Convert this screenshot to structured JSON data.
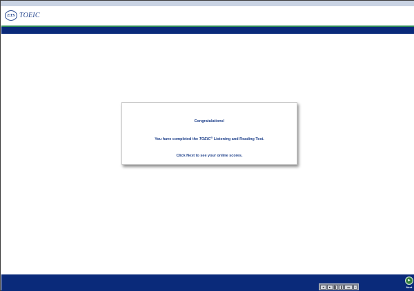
{
  "header": {
    "logo_ets": "ETS",
    "logo_product": "TOEIC"
  },
  "dialog": {
    "line1": "Congratulations!",
    "line2_pre": "You have completed the ",
    "line2_product": "TOEIC",
    "line2_reg": "®",
    "line2_post": " Listening and Reading Test.",
    "line3": "Click Next to see your online scores."
  },
  "footer": {
    "tools": [
      "◄",
      "►",
      "▌",
      "▐",
      "▬",
      "▪"
    ],
    "next_icon": "►",
    "next_label": "Next"
  },
  "colors": {
    "brand_navy": "#0a2a7a",
    "accent_green": "#2e8b57",
    "text_blue": "#1d3f8a"
  }
}
